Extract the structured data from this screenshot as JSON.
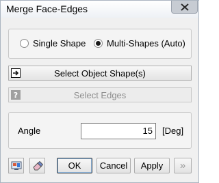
{
  "window": {
    "title": "Merge Face-Edges",
    "close_icon": "close-icon"
  },
  "mode": {
    "options": [
      {
        "label": "Single Shape",
        "selected": false
      },
      {
        "label": "Multi-Shapes (Auto)",
        "selected": true
      }
    ]
  },
  "select_object": {
    "label": "Select Object Shape(s)",
    "icon": "selection-arrow-icon"
  },
  "select_edges": {
    "label": "Select Edges",
    "icon": "help-icon",
    "enabled": false
  },
  "angle": {
    "label": "Angle",
    "value": "15",
    "unit": "[Deg]"
  },
  "footer": {
    "icons": [
      "preview-icon",
      "eraser-icon"
    ],
    "ok_label": "OK",
    "cancel_label": "Cancel",
    "apply_label": "Apply",
    "more_label": "»"
  }
}
